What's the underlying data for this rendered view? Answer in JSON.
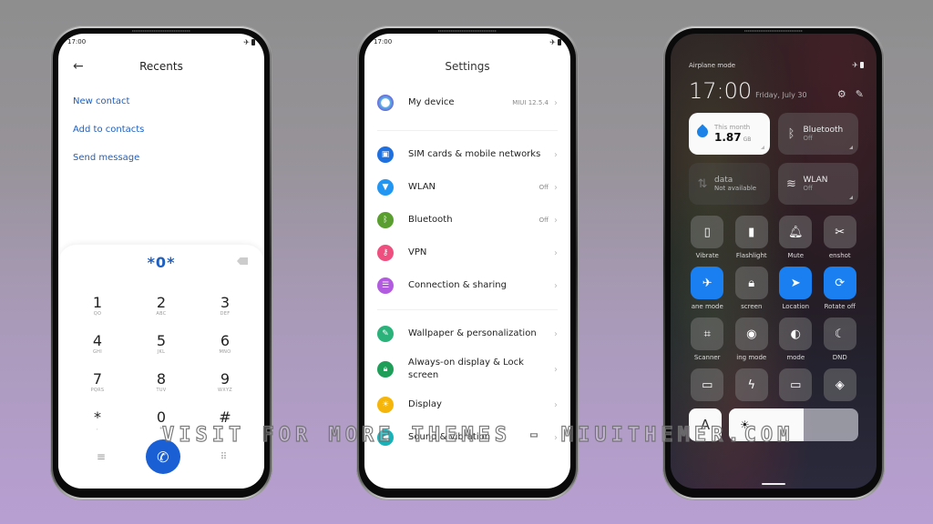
{
  "status_time": "17:00",
  "phone_dialer": {
    "title": "Recents",
    "actions": [
      "New contact",
      "Add to contacts",
      "Send message"
    ],
    "dial_input": "*0*",
    "keys": [
      {
        "digit": "1",
        "letters": "QO"
      },
      {
        "digit": "2",
        "letters": "ABC"
      },
      {
        "digit": "3",
        "letters": "DEF"
      },
      {
        "digit": "4",
        "letters": "GHI"
      },
      {
        "digit": "5",
        "letters": "JKL"
      },
      {
        "digit": "6",
        "letters": "MNO"
      },
      {
        "digit": "7",
        "letters": "PQRS"
      },
      {
        "digit": "8",
        "letters": "TUV"
      },
      {
        "digit": "9",
        "letters": "WXYZ"
      },
      {
        "digit": "*",
        "letters": ","
      },
      {
        "digit": "0",
        "letters": "+"
      },
      {
        "digit": "#",
        "letters": ""
      }
    ]
  },
  "phone_settings": {
    "title": "Settings",
    "my_device": {
      "label": "My device",
      "value": "MIUI 12.5.4",
      "color": "#4a6fe0"
    },
    "group1": [
      {
        "label": "SIM cards & mobile networks",
        "value": "",
        "color": "#1e6fe0",
        "icon": "sim-card"
      },
      {
        "label": "WLAN",
        "value": "Off",
        "color": "#2196f3",
        "icon": "wifi"
      },
      {
        "label": "Bluetooth",
        "value": "Off",
        "color": "#5a9e2f",
        "icon": "bluetooth"
      },
      {
        "label": "VPN",
        "value": "",
        "color": "#ef4f7e",
        "icon": "key"
      },
      {
        "label": "Connection & sharing",
        "value": "",
        "color": "#b25be0",
        "icon": "list"
      }
    ],
    "group2": [
      {
        "label": "Wallpaper & personalization",
        "value": "",
        "color": "#2ab27a",
        "icon": "brush"
      },
      {
        "label": "Always-on display & Lock screen",
        "value": "",
        "color": "#1f9e5a",
        "icon": "lock"
      },
      {
        "label": "Display",
        "value": "",
        "color": "#f5b50a",
        "icon": "sun"
      },
      {
        "label": "Sound & vibration",
        "value": "",
        "color": "#19b2b8",
        "icon": "speaker"
      }
    ]
  },
  "phone_control_center": {
    "status_label": "Airplane mode",
    "time": "17:00",
    "date": "Friday, July 30",
    "data_tile": {
      "caption": "This month",
      "value": "1.87",
      "unit": "GB"
    },
    "bluetooth_tile": {
      "title": "Bluetooth",
      "state": "Off"
    },
    "mobile_data_tile": {
      "title": "data",
      "state": "Not available"
    },
    "wlan_tile": {
      "title": "WLAN",
      "state": "Off"
    },
    "toggles": [
      {
        "label": "Vibrate",
        "icon": "vibrate",
        "on": false
      },
      {
        "label": "Flashlight",
        "icon": "flashlight",
        "on": false
      },
      {
        "label": "Mute",
        "icon": "bell",
        "on": false
      },
      {
        "label": "enshot",
        "icon": "screenshot",
        "on": false
      },
      {
        "label": "ane mode",
        "icon": "airplane",
        "on": true
      },
      {
        "label": "screen",
        "icon": "lock",
        "on": false
      },
      {
        "label": "Location",
        "icon": "location",
        "on": true
      },
      {
        "label": "Rotate off",
        "icon": "rotate-lock",
        "on": true
      },
      {
        "label": "Scanner",
        "icon": "scanner",
        "on": false
      },
      {
        "label": "ing mode",
        "icon": "eye",
        "on": false
      },
      {
        "label": "mode",
        "icon": "contrast",
        "on": false
      },
      {
        "label": "DND",
        "icon": "moon",
        "on": false
      },
      {
        "label": "",
        "icon": "battery-saver",
        "on": false
      },
      {
        "label": "",
        "icon": "lightning",
        "on": false
      },
      {
        "label": "",
        "icon": "monitor",
        "on": false
      },
      {
        "label": "",
        "icon": "cast",
        "on": false
      }
    ],
    "font_button_label": "A",
    "brightness_level": 0.58,
    "accent": "#1a7ff0"
  },
  "watermark": "VISIT FOR MORE THEMES - MIUITHEMER.COM"
}
